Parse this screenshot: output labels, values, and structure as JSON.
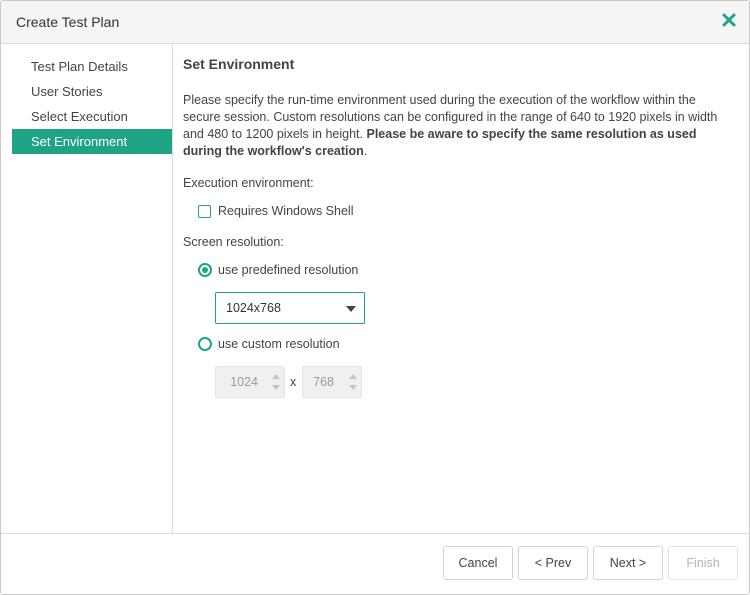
{
  "dialog": {
    "title": "Create Test Plan",
    "close_icon": "close-icon"
  },
  "nav": {
    "items": [
      {
        "label": "Test Plan Details",
        "active": false
      },
      {
        "label": "User Stories",
        "active": false
      },
      {
        "label": "Select Execution",
        "active": false
      },
      {
        "label": "Set Environment",
        "active": true
      }
    ]
  },
  "content": {
    "heading": "Set Environment",
    "description_plain": "Please specify the run-time environment used during the execution of the workflow within the secure session. Custom resolutions can be configured in the range of 640 to 1920 pixels in width and 480 to 1200 pixels in height. ",
    "description_bold": "Please be aware to specify the same resolution as used during the workflow's creation",
    "description_end": ".",
    "execution_label": "Execution environment:",
    "windows_shell_label": "Requires Windows Shell",
    "windows_shell_checked": false,
    "resolution_label": "Screen resolution:",
    "predefined_label": "use predefined resolution",
    "predefined_selected": true,
    "predefined_value": "1024x768",
    "custom_label": "use custom resolution",
    "custom_selected": false,
    "custom_width": "1024",
    "custom_separator": "x",
    "custom_height": "768"
  },
  "footer": {
    "cancel_label": "Cancel",
    "prev_label": "< Prev",
    "next_label": "Next >",
    "finish_label": "Finish"
  },
  "colors": {
    "accent": "#1fa385",
    "disabled_text": "#b5b5b5"
  }
}
